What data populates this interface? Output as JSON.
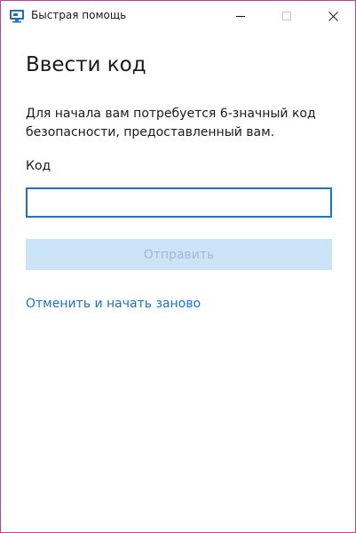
{
  "window": {
    "title": "Быстрая помощь",
    "app_icon": "quick-assist-monitor-icon",
    "controls": [
      "minimize-icon",
      "maximize-icon",
      "close-icon"
    ]
  },
  "main": {
    "heading": "Ввести код",
    "description": "Для начала вам потребуется 6-значный код безопасности, предоставленный вам.",
    "code_label": "Код",
    "code_value": "",
    "submit_label": "Отправить",
    "cancel_link": "Отменить и начать заново"
  },
  "colors": {
    "accent": "#1a73c8",
    "button_disabled_bg": "#cce4f7",
    "button_disabled_text": "#9fbad3",
    "window_border": "#c2418c"
  }
}
